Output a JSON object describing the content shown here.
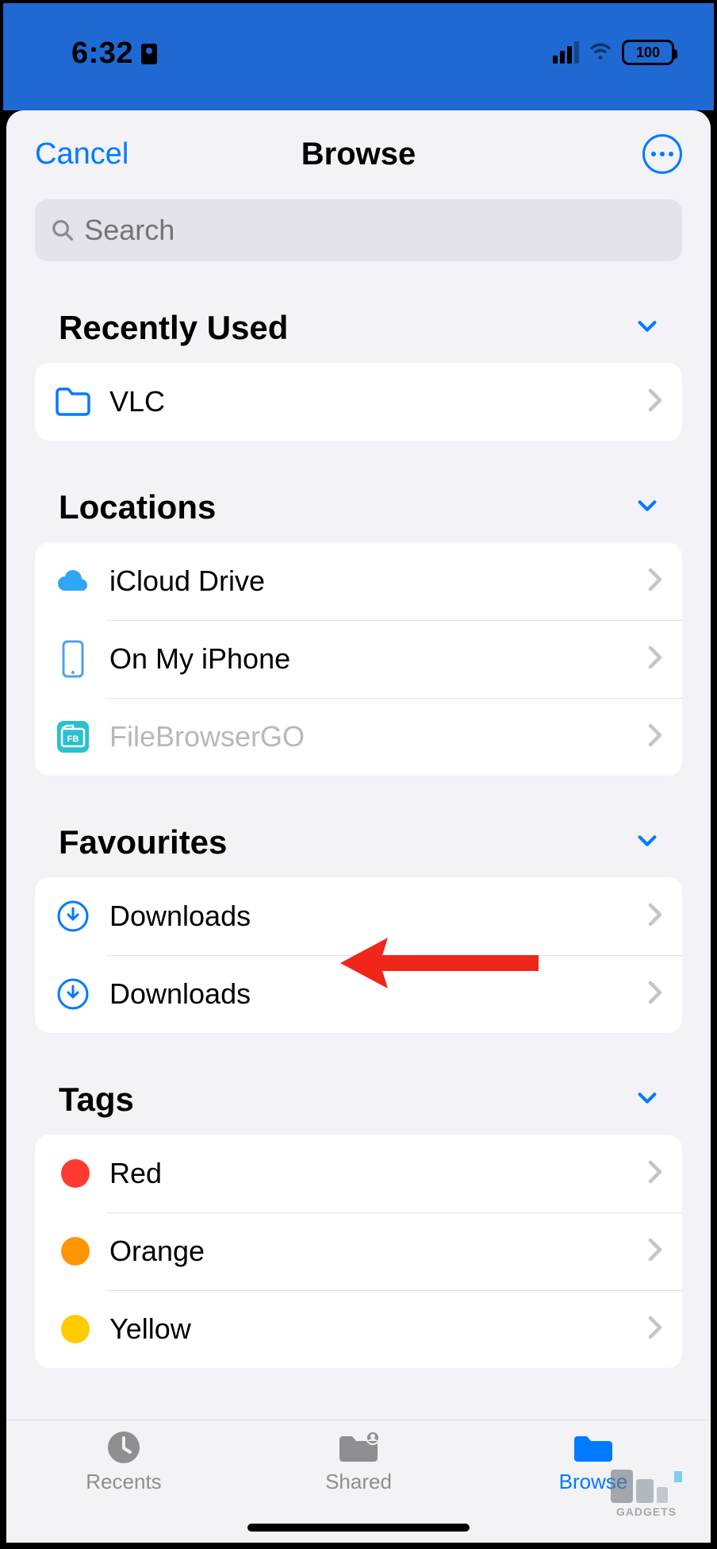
{
  "status": {
    "time": "6:32",
    "battery": "100"
  },
  "nav": {
    "cancel": "Cancel",
    "title": "Browse"
  },
  "search": {
    "placeholder": "Search"
  },
  "sections": {
    "recently_used": {
      "title": "Recently Used",
      "items": [
        {
          "label": "VLC"
        }
      ]
    },
    "locations": {
      "title": "Locations",
      "items": [
        {
          "label": "iCloud Drive"
        },
        {
          "label": "On My iPhone"
        },
        {
          "label": "FileBrowserGO",
          "dimmed": true
        }
      ]
    },
    "favourites": {
      "title": "Favourites",
      "items": [
        {
          "label": "Downloads"
        },
        {
          "label": "Downloads"
        }
      ]
    },
    "tags": {
      "title": "Tags",
      "items": [
        {
          "label": "Red",
          "color": "#ff3b30"
        },
        {
          "label": "Orange",
          "color": "#ff9500"
        },
        {
          "label": "Yellow",
          "color": "#ffcc00"
        }
      ]
    }
  },
  "tabs": {
    "recents": "Recents",
    "shared": "Shared",
    "browse": "Browse"
  },
  "watermark_text": "GADGETS"
}
